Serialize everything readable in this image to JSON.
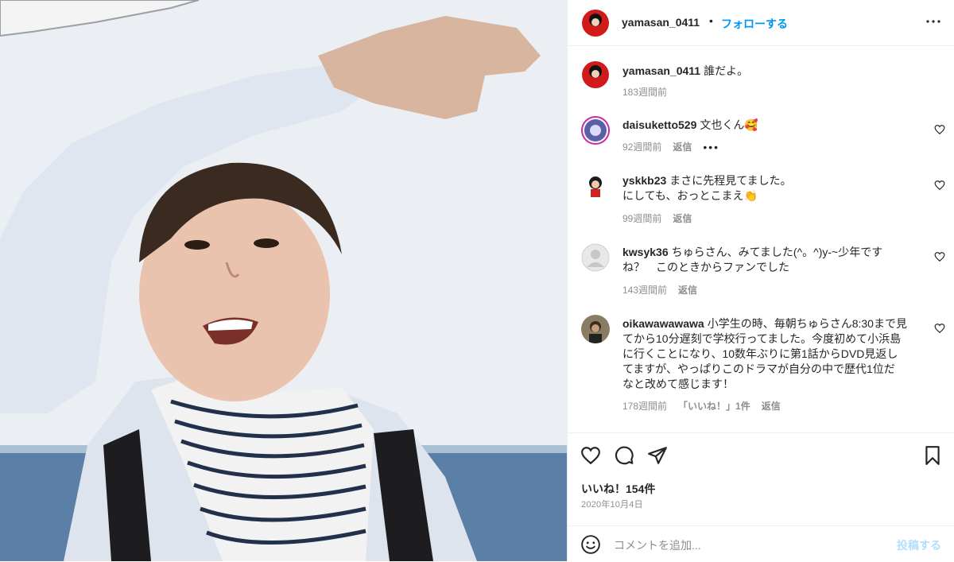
{
  "header": {
    "username": "yamasan_0411",
    "separator": "•",
    "follow_label": "フォローする"
  },
  "caption": {
    "username": "yamasan_0411",
    "text": "誰だよ。",
    "time": "183週間前"
  },
  "comments": [
    {
      "username": "daisuketto529",
      "text": "文也くん🥰",
      "time": "92週間前",
      "reply_label": "返信",
      "more": "•••"
    },
    {
      "username": "yskkb23",
      "text": "まさに先程見てました。",
      "text2": "にしても、おっとこまえ👏",
      "time": "99週間前",
      "reply_label": "返信"
    },
    {
      "username": "kwsyk36",
      "text": "ちゅらさん、みてました(^。^)y-~少年です",
      "text2": "ね？　このときからファンでした",
      "time": "143週間前",
      "reply_label": "返信"
    },
    {
      "username": "oikawawawawa",
      "text": "小学生の時、毎朝ちゅらさん8:30まで見",
      "text2": "てから10分遅刻で学校行ってました。今度初めて小浜島",
      "text3": "に行くことになり、10数年ぶりに第1話からDVD見返し",
      "text4": "てますが、やっぱりこのドラマが自分の中で歴代1位だ",
      "text5": "なと改めて感じます！",
      "time": "178週間前",
      "likes_label": "「いいね！」1件",
      "reply_label": "返信"
    }
  ],
  "actions": {
    "like_icon": "heart-icon",
    "comment_icon": "comment-icon",
    "share_icon": "share-icon",
    "save_icon": "bookmark-icon"
  },
  "likes_text": "いいね！154件",
  "date": "2020年10月4日",
  "comment_box": {
    "placeholder": "コメントを追加...",
    "post_label": "投稿する"
  },
  "colors": {
    "accent": "#0095f6",
    "muted": "#8e8e8e",
    "post_disabled": "#b2dffc"
  }
}
